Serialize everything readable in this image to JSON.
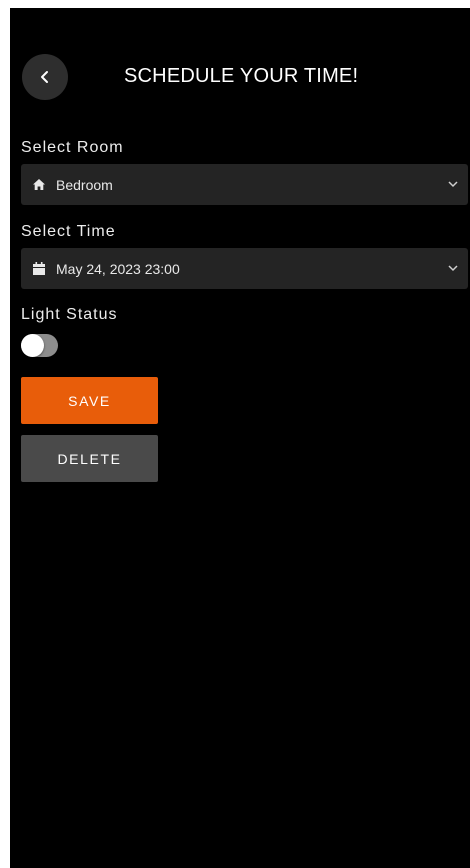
{
  "header": {
    "back_icon": "chevron-left-icon",
    "title": "SCHEDULE YOUR TIME!"
  },
  "room": {
    "label": "Select Room",
    "icon": "home-icon",
    "value": "Bedroom"
  },
  "time": {
    "label": "Select Time",
    "icon": "calendar-icon",
    "value": "May 24, 2023 23:00"
  },
  "light": {
    "label": "Light Status",
    "on": false
  },
  "actions": {
    "save_label": "SAVE",
    "delete_label": "DELETE"
  },
  "colors": {
    "background": "#000000",
    "accent": "#e85d0a",
    "secondary_button": "#4a4a4a",
    "field_background": "#242424"
  }
}
